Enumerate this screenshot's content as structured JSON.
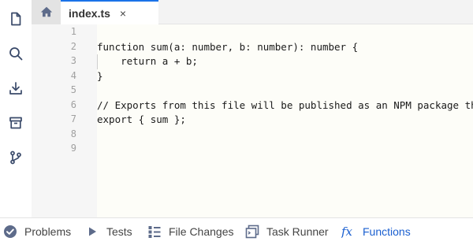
{
  "activity_bar": {
    "icons": [
      "file-icon",
      "search-icon",
      "download-icon",
      "package-icon",
      "git-branch-icon"
    ]
  },
  "tabs": {
    "home_icon": "home-icon",
    "file_tab": {
      "label": "index.ts",
      "close": "×"
    }
  },
  "editor": {
    "line_numbers": [
      "1",
      "2",
      "3",
      "4",
      "5",
      "6",
      "7",
      "8",
      "9"
    ],
    "lines": [
      "",
      "function sum(a: number, b: number): number {",
      "    return a + b;",
      "}",
      "",
      "// Exports from this file will be published as an NPM package th",
      "export { sum };",
      "",
      ""
    ]
  },
  "bottom_panel": {
    "tabs": [
      {
        "label": "Problems",
        "icon": "check-circle-icon"
      },
      {
        "label": "Tests",
        "icon": "play-icon"
      },
      {
        "label": "File Changes",
        "icon": "file-changes-icon"
      },
      {
        "label": "Task Runner",
        "icon": "terminal-icon"
      },
      {
        "label": "Functions",
        "icon": "function-icon",
        "active": true
      }
    ]
  },
  "colors": {
    "accent": "#1a73e8",
    "active_tab_text": "#1a5fd0",
    "gutter_bg": "#f6f6f6",
    "code_bg": "#fdfdf8"
  }
}
